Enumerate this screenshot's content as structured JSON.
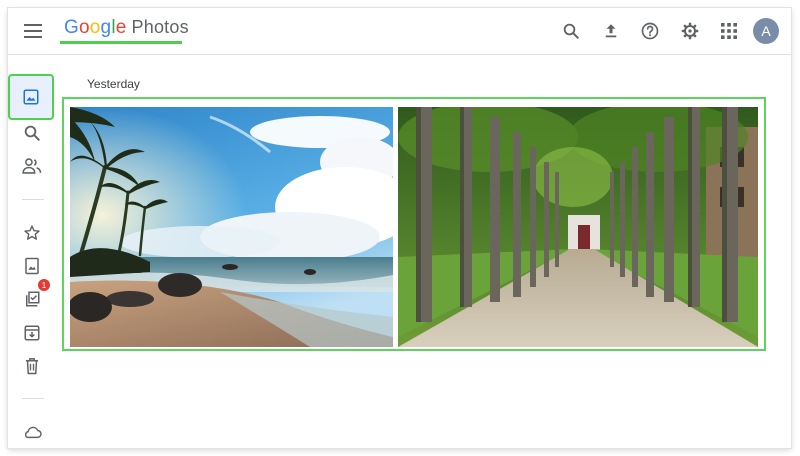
{
  "header": {
    "logo_brand": [
      "G",
      "o",
      "o",
      "g",
      "l",
      "e"
    ],
    "logo_colors": [
      "#4285F4",
      "#EA4335",
      "#FBBC05",
      "#4285F4",
      "#34A853",
      "#EA4335"
    ],
    "product": "Photos",
    "avatar_letter": "A",
    "icons": [
      "search-icon",
      "upload-icon",
      "help-icon",
      "settings-icon",
      "apps-grid-icon"
    ]
  },
  "sidebar": {
    "items": [
      {
        "name": "photos",
        "icon": "photo-icon",
        "active": true
      },
      {
        "name": "explore",
        "icon": "search-icon"
      },
      {
        "name": "sharing",
        "icon": "people-icon"
      },
      {
        "name": "favorites",
        "icon": "star-icon"
      },
      {
        "name": "albums",
        "icon": "album-icon"
      },
      {
        "name": "utilities",
        "icon": "checklist-icon",
        "badge": "1"
      },
      {
        "name": "archive",
        "icon": "archive-icon"
      },
      {
        "name": "trash",
        "icon": "trash-icon"
      },
      {
        "name": "storage",
        "icon": "cloud-icon"
      }
    ]
  },
  "main": {
    "section_title": "Yesterday",
    "photos": [
      {
        "name": "beach-photo"
      },
      {
        "name": "tree-avenue-photo"
      }
    ]
  },
  "colors": {
    "highlight": "#4cd14c",
    "badge": "#e53935",
    "icon": "#5f6368",
    "active_icon": "#1a73e8"
  }
}
